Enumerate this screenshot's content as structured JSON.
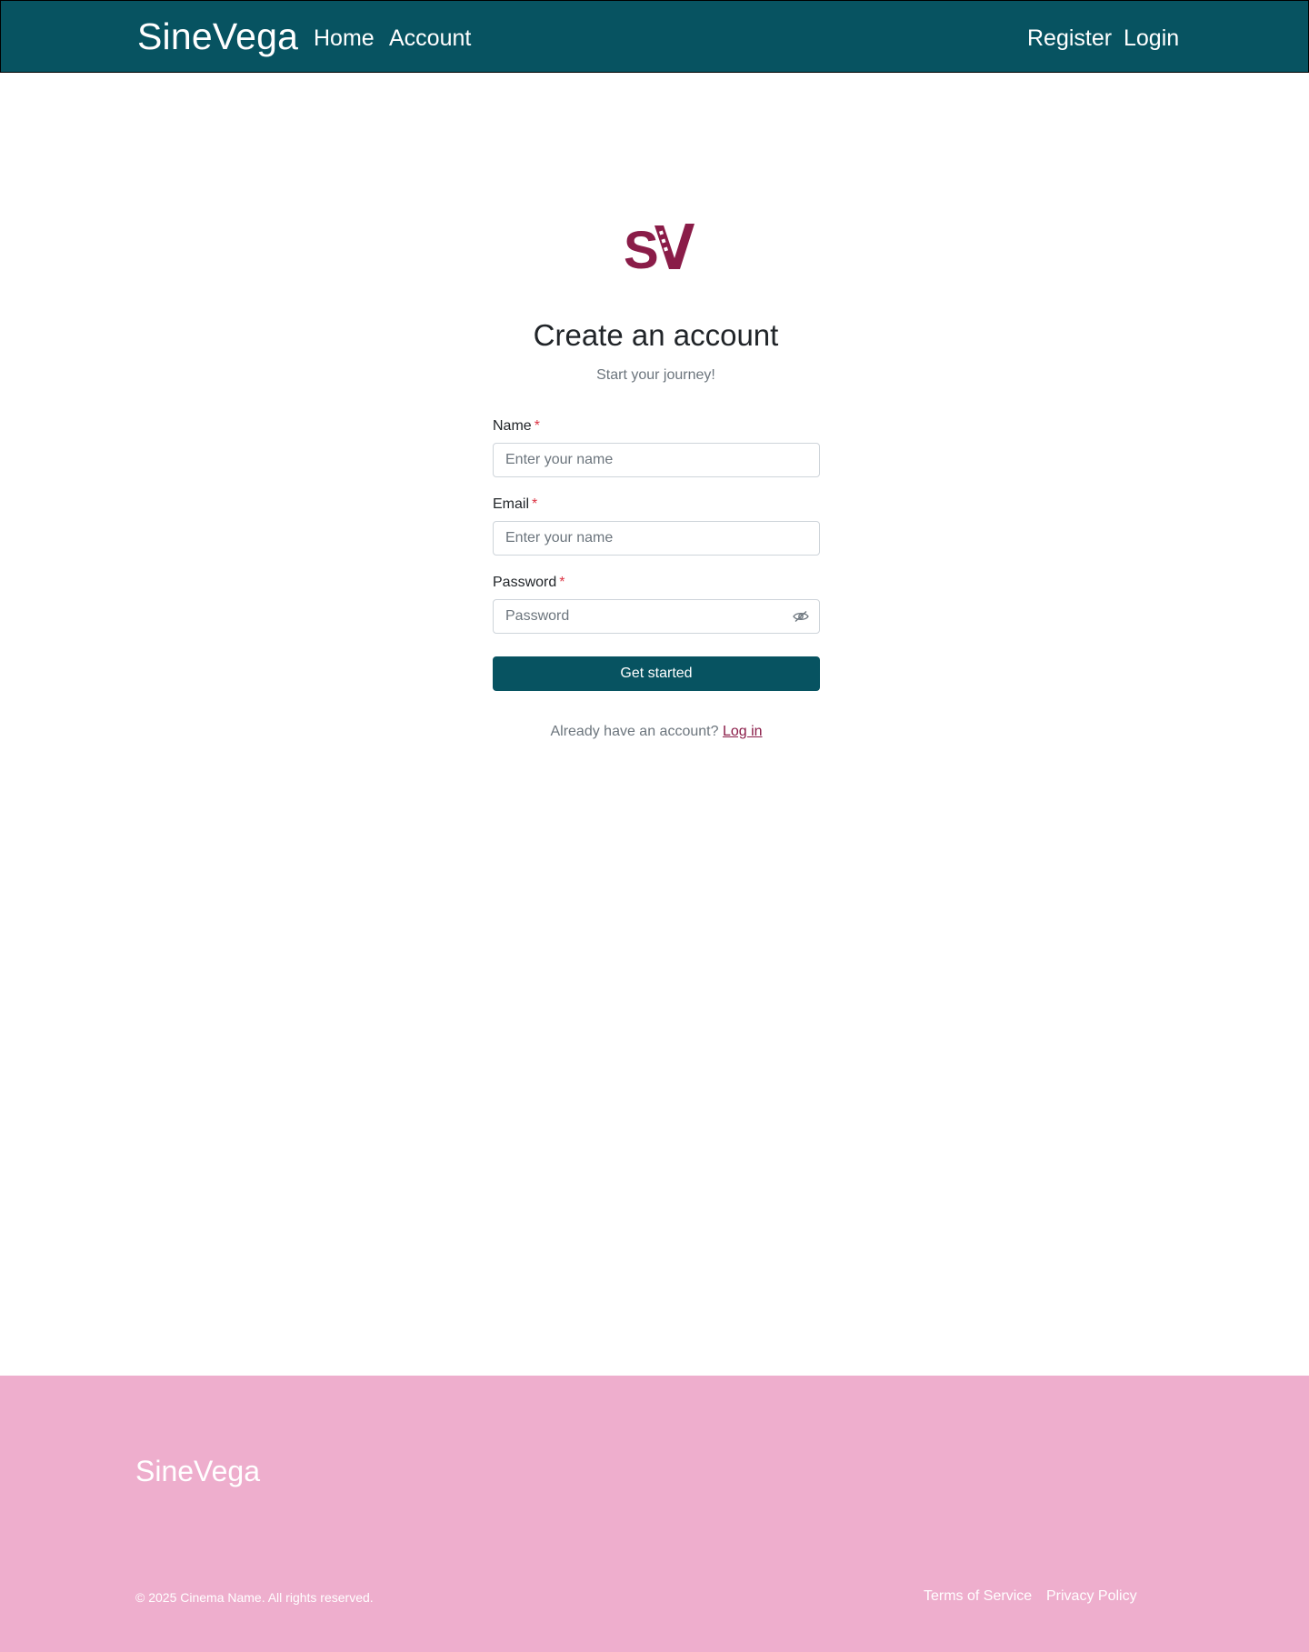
{
  "header": {
    "brand": "SineVega",
    "nav_left": {
      "home": "Home",
      "account": "Account"
    },
    "nav_right": {
      "register": "Register",
      "login": "Login"
    }
  },
  "logo": {
    "text": "SV",
    "color": "#8a1c48"
  },
  "main": {
    "title": "Create an account",
    "subtitle": "Start your journey!"
  },
  "form": {
    "name": {
      "label": "Name",
      "required_mark": "*",
      "placeholder": "Enter your name",
      "value": ""
    },
    "email": {
      "label": "Email",
      "required_mark": "*",
      "placeholder": "Enter your name",
      "value": ""
    },
    "password": {
      "label": "Password",
      "required_mark": "*",
      "placeholder": "Password",
      "value": "",
      "toggle_icon": "eye-icon"
    },
    "submit_label": "Get started",
    "login_prompt": "Already have an account?",
    "login_link": "Log in"
  },
  "footer": {
    "brand": "SineVega",
    "copyright": "© 2025 Cinema Name. All rights reserved.",
    "links": {
      "terms": "Terms of Service",
      "privacy": "Privacy Policy"
    }
  },
  "colors": {
    "header_bg": "#075361",
    "primary_button": "#075361",
    "accent": "#8a1c48",
    "footer_bg": "#eeaecd",
    "required": "#dc3545"
  }
}
